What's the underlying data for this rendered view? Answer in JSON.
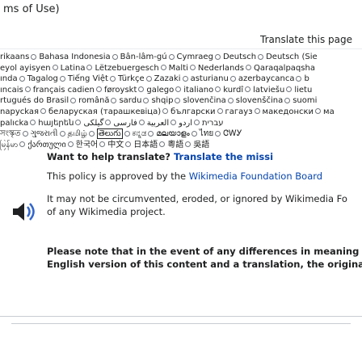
{
  "header": {
    "title": "ms of Use)",
    "translate_label": "Translate this page"
  },
  "languages": [
    [
      "rikaans",
      "Bahasa Indonesia",
      "Bân-lâm-gú",
      "Cymraeg",
      "Deutsch",
      "Deutsch (Sie"
    ],
    [
      "eyol ayisyen",
      "Latina",
      "Lëtzebuergesch",
      "Malti",
      "Nederlands",
      "Qaraqalpaqsha"
    ],
    [
      "ında",
      "Tagalog",
      "Tiếng Việt",
      "Türkçe",
      "Zazaki",
      "asturianu",
      "azerbaycanca",
      "b"
    ],
    [
      "ıncais",
      "français cadien",
      "føroyskt",
      "galego",
      "italiano",
      "kurdî",
      "latviešu",
      "lietu"
    ],
    [
      "rtugués do Brasil",
      "română",
      "sardu",
      "shqip",
      "slovenčina",
      "slovenščina",
      "suomi"
    ],
    [
      "napyckaя",
      "беларуская (тарашкевіца)",
      "български",
      "гагауз",
      "македонски",
      "ма"
    ],
    [
      "palıcka",
      "հայերեն",
      "עברית",
      "اردو",
      "العربية",
      "فارسی",
      "گیلکی"
    ],
    [
      "সংস্কৃত",
      "ગુજરાતી",
      "தமிழ்",
      "తెలుగు",
      "ಕನ್ನಡ",
      "മലയാളം",
      "ไทย",
      "ᏣᎳᎩ"
    ],
    [
      "မြန်မာ",
      "ქართული",
      "한국어",
      "中文",
      "日本語",
      "粵語",
      "吳語"
    ]
  ],
  "help": {
    "prompt": "Want to help translate?",
    "link": "Translate the missi"
  },
  "policy": {
    "prefix": "This policy is approved by the ",
    "link": "Wikimedia Foundation Board"
  },
  "audio": {
    "text": "It may not be circumvented, eroded, or ignored by Wikimedia Fo of any Wikimedia project."
  },
  "notice": {
    "line1": "Please note that in the event of any differences in meaning c",
    "line2": "English version of this content and a translation, the origina"
  },
  "colors": {
    "link": "#0645ad",
    "text": "#202122",
    "border": "#c8ccd1"
  },
  "icons": {
    "audio": "speaker-icon"
  }
}
